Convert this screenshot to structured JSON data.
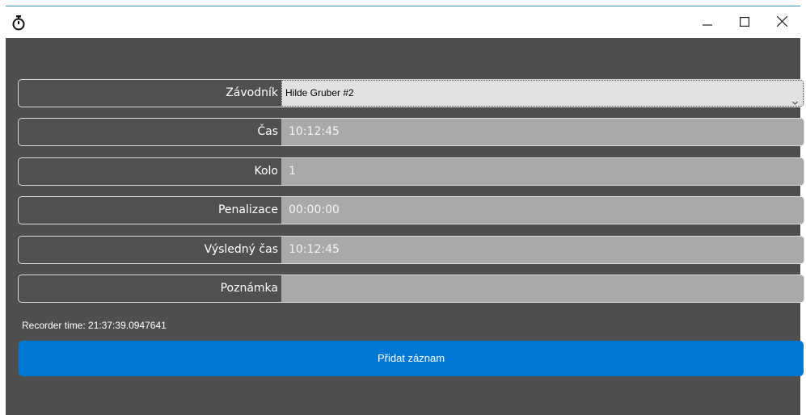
{
  "window": {
    "app_icon": "stopwatch-icon",
    "controls": {
      "minimize": "minimize-icon",
      "maximize": "maximize-icon",
      "close": "close-icon"
    }
  },
  "form": {
    "racer": {
      "label": "Závodník",
      "value": "Hilde Gruber #2",
      "icon": "chevron-down-icon"
    },
    "time": {
      "label": "Čas",
      "value": "10:12:45"
    },
    "lap": {
      "label": "Kolo",
      "value": "1"
    },
    "penalty": {
      "label": "Penalizace",
      "value": "00:00:00"
    },
    "result_time": {
      "label": "Výsledný čas",
      "value": "10:12:45"
    },
    "note": {
      "label": "Poznámka",
      "value": ""
    }
  },
  "recorder_time": "Recorder time: 21:37:39.0947641",
  "add_button": {
    "label": "Přidat záznam"
  },
  "colors": {
    "background": "#4f4f4f",
    "field_readonly": "#a9a9a9",
    "select_bg": "#e1e1e1",
    "primary": "#0078d4",
    "title_bar": "#ffffff"
  }
}
